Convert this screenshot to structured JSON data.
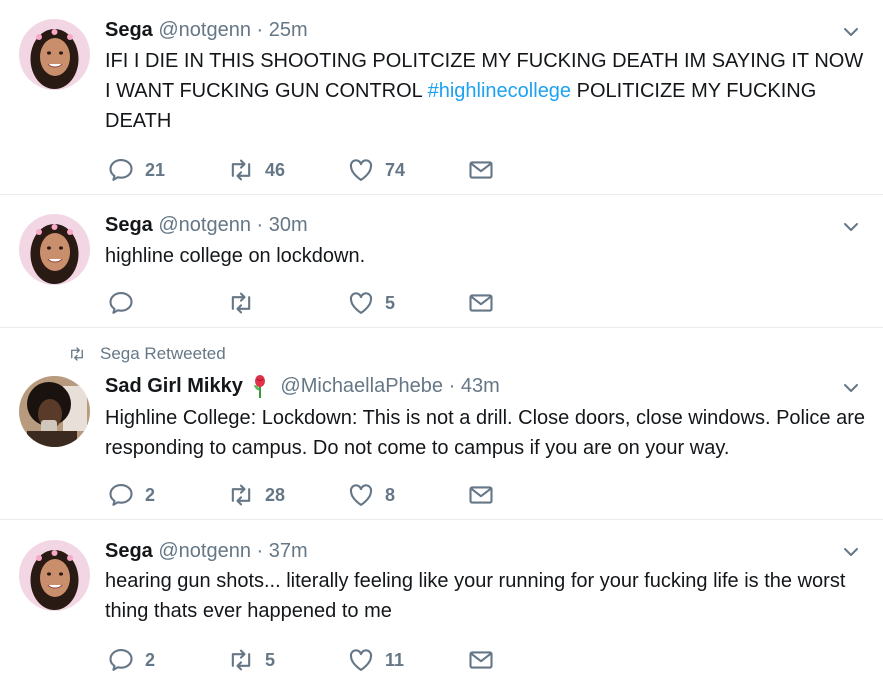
{
  "tweets": [
    {
      "name": "Sega",
      "handle": "@notgenn",
      "sep": "·",
      "time": "25m",
      "text_before": "IFI I DIE IN THIS SHOOTING POLITCIZE MY FUCKING DEATH IM SAYING IT NOW I WANT FUCKING GUN CONTROL ",
      "hashtag": "#highlinecollege",
      "text_after": " POLITICIZE MY FUCKING DEATH",
      "replies": "21",
      "retweets": "46",
      "likes": "74"
    },
    {
      "name": "Sega",
      "handle": "@notgenn",
      "sep": "·",
      "time": "30m",
      "text": "highline college on lockdown.",
      "replies": "",
      "retweets": "",
      "likes": "5"
    },
    {
      "retweeted_by": "Sega Retweeted",
      "name": "Sad Girl Mikky",
      "handle": "@MichaellaPhebe",
      "sep": "·",
      "time": "43m",
      "text": "Highline College: Lockdown: This is not a drill. Close doors, close windows. Police are responding to campus. Do not come to campus if you are on your way.",
      "replies": "2",
      "retweets": "28",
      "likes": "8"
    },
    {
      "name": "Sega",
      "handle": "@notgenn",
      "sep": "·",
      "time": "37m",
      "text": "hearing gun shots... literally feeling like your running for your fucking life is the worst thing thats ever happened to me",
      "replies": "2",
      "retweets": "5",
      "likes": "11"
    }
  ],
  "icons": {
    "reply": "reply-icon",
    "retweet": "retweet-icon",
    "like": "heart-icon",
    "dm": "envelope-icon",
    "caret": "chevron-down-icon"
  },
  "colors": {
    "icon_gray": "#657786",
    "link_blue": "#1da1f2",
    "divider": "#e6ecf0"
  }
}
